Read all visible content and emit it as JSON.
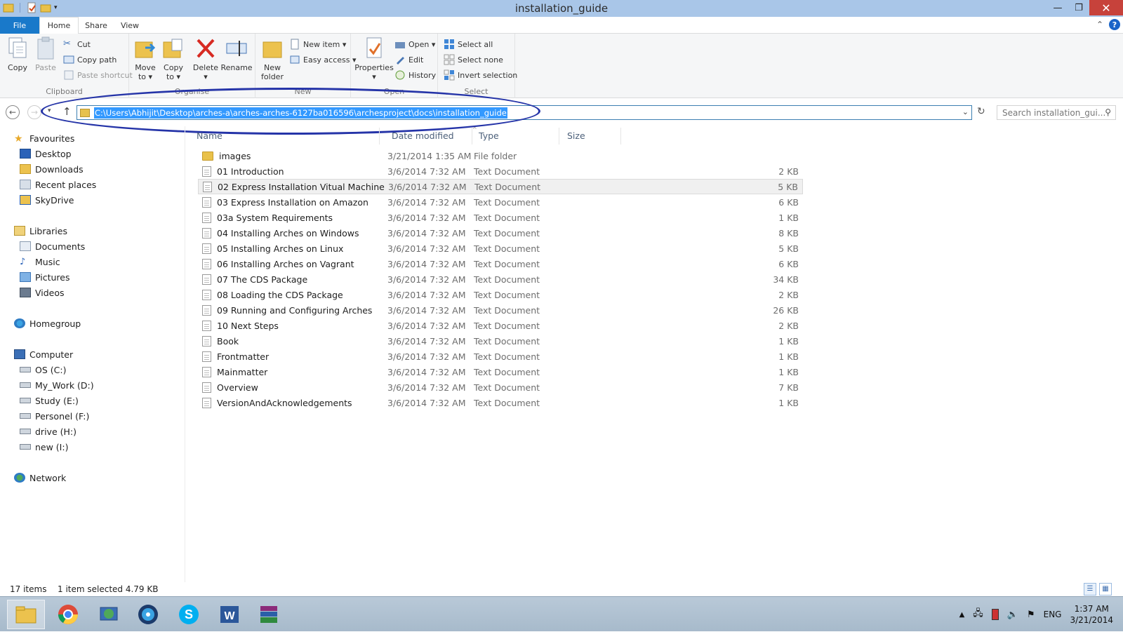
{
  "window": {
    "title": "installation_guide",
    "minimize": "—",
    "maximize": "❐",
    "close": "✕"
  },
  "ribbon_tabs": [
    {
      "label": "File"
    },
    {
      "label": "Home"
    },
    {
      "label": "Share"
    },
    {
      "label": "View"
    }
  ],
  "ribbon": {
    "clipboard": {
      "group_label": "Clipboard",
      "copy": "Copy",
      "paste": "Paste",
      "cut": "Cut",
      "copy_path": "Copy path",
      "paste_shortcut": "Paste shortcut"
    },
    "organise": {
      "group_label": "Organise",
      "move_to_1": "Move",
      "move_to_2": "to ▾",
      "copy_to_1": "Copy",
      "copy_to_2": "to ▾",
      "delete": "Delete",
      "delete_arrow": "▾",
      "rename": "Rename"
    },
    "new": {
      "group_label": "New",
      "new_folder_1": "New",
      "new_folder_2": "folder",
      "new_item": "New item ▾",
      "easy_access": "Easy access ▾"
    },
    "open": {
      "group_label": "Open",
      "properties": "Properties",
      "properties_arrow": "▾",
      "open": "Open ▾",
      "edit": "Edit",
      "history": "History"
    },
    "select": {
      "group_label": "Select",
      "select_all": "Select all",
      "select_none": "Select none",
      "invert_selection": "Invert selection"
    }
  },
  "address": {
    "path": "C:\\Users\\Abhijit\\Desktop\\arches-a\\arches-arches-6127ba016596\\archesproject\\docs\\installation_guide",
    "search_placeholder": "Search installation_gui..."
  },
  "nav_pane": {
    "favourites": "Favourites",
    "desktop": "Desktop",
    "downloads": "Downloads",
    "recent_places": "Recent places",
    "skydrive": "SkyDrive",
    "libraries": "Libraries",
    "documents": "Documents",
    "music": "Music",
    "pictures": "Pictures",
    "videos": "Videos",
    "homegroup": "Homegroup",
    "computer": "Computer",
    "os_c": "OS (C:)",
    "my_work_d": "My_Work (D:)",
    "study_e": "Study (E:)",
    "personel_f": "Personel (F:)",
    "drive_h": "drive (H:)",
    "new_i": "new (I:)",
    "network": "Network"
  },
  "columns": {
    "name": "Name",
    "date_modified": "Date modified",
    "type": "Type",
    "size": "Size"
  },
  "files": [
    {
      "name": "images",
      "date": "3/21/2014 1:35 AM",
      "type": "File folder",
      "size": ""
    },
    {
      "name": "01 Introduction",
      "date": "3/6/2014 7:32 AM",
      "type": "Text Document",
      "size": "2 KB"
    },
    {
      "name": "02 Express Installation Vitual Machine",
      "date": "3/6/2014 7:32 AM",
      "type": "Text Document",
      "size": "5 KB"
    },
    {
      "name": "03 Express Installation on Amazon",
      "date": "3/6/2014 7:32 AM",
      "type": "Text Document",
      "size": "6 KB"
    },
    {
      "name": "03a System Requirements",
      "date": "3/6/2014 7:32 AM",
      "type": "Text Document",
      "size": "1 KB"
    },
    {
      "name": "04 Installing Arches on Windows",
      "date": "3/6/2014 7:32 AM",
      "type": "Text Document",
      "size": "8 KB"
    },
    {
      "name": "05 Installing Arches on Linux",
      "date": "3/6/2014 7:32 AM",
      "type": "Text Document",
      "size": "5 KB"
    },
    {
      "name": "06 Installing Arches on Vagrant",
      "date": "3/6/2014 7:32 AM",
      "type": "Text Document",
      "size": "6 KB"
    },
    {
      "name": "07 The CDS Package",
      "date": "3/6/2014 7:32 AM",
      "type": "Text Document",
      "size": "34 KB"
    },
    {
      "name": "08 Loading the CDS Package",
      "date": "3/6/2014 7:32 AM",
      "type": "Text Document",
      "size": "2 KB"
    },
    {
      "name": "09 Running and Configuring Arches",
      "date": "3/6/2014 7:32 AM",
      "type": "Text Document",
      "size": "26 KB"
    },
    {
      "name": "10 Next Steps",
      "date": "3/6/2014 7:32 AM",
      "type": "Text Document",
      "size": "2 KB"
    },
    {
      "name": "Book",
      "date": "3/6/2014 7:32 AM",
      "type": "Text Document",
      "size": "1 KB"
    },
    {
      "name": "Frontmatter",
      "date": "3/6/2014 7:32 AM",
      "type": "Text Document",
      "size": "1 KB"
    },
    {
      "name": "Mainmatter",
      "date": "3/6/2014 7:32 AM",
      "type": "Text Document",
      "size": "1 KB"
    },
    {
      "name": "Overview",
      "date": "3/6/2014 7:32 AM",
      "type": "Text Document",
      "size": "7 KB"
    },
    {
      "name": "VersionAndAcknowledgements",
      "date": "3/6/2014 7:32 AM",
      "type": "Text Document",
      "size": "1 KB"
    }
  ],
  "status": {
    "item_count": "17 items",
    "selection": "1 item selected  4.79 KB"
  },
  "taskbar": {
    "language": "ENG",
    "time": "1:37 AM",
    "date": "3/21/2014"
  },
  "colors": {
    "accent": "#1979ca",
    "title_bar": "#a9c6e8",
    "close_button": "#c7423b",
    "selection_highlight": "#3399ff",
    "annotation_ellipse": "#2534a8"
  }
}
